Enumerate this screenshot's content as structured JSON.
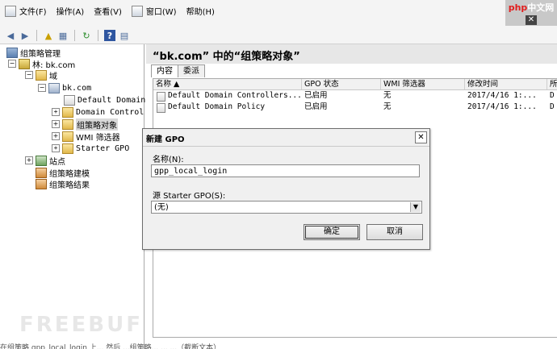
{
  "menubar": {
    "items": [
      "文件(F)",
      "操作(A)",
      "查看(V)",
      "窗口(W)",
      "帮助(H)"
    ],
    "window_controls": [
      "_",
      "▫",
      "×"
    ]
  },
  "watermark": {
    "brand_prefix": "php",
    "brand_suffix": "中文网",
    "close_glyph": "✕"
  },
  "toolbar": {
    "buttons": [
      "back-icon",
      "forward-icon",
      "up-icon",
      "show-hide-tree-icon",
      "refresh-icon",
      "help-icon",
      "view-icon"
    ]
  },
  "tree": {
    "root": "组策略管理",
    "forest": "林: bk.com",
    "domains": "域",
    "domain": "bk.com",
    "items": [
      "Default Domain",
      "Domain Control",
      "组策略对象",
      "WMI 筛选器",
      "Starter GPO"
    ],
    "sites": "站点",
    "modeling": "组策略建模",
    "results": "组策略结果"
  },
  "main": {
    "title": "“bk.com” 中的“组策略对象”",
    "tabs": [
      "内容",
      "委派"
    ],
    "columns": [
      "名称 ▲",
      "GPO 状态",
      "WMI 筛选器",
      "修改时间",
      "所"
    ],
    "rows": [
      [
        "Default Domain Controllers...",
        "已启用",
        "无",
        "2017/4/16 1:...",
        "D"
      ],
      [
        "Default Domain Policy",
        "已启用",
        "无",
        "2017/4/16 1:...",
        "D"
      ]
    ]
  },
  "dialog": {
    "title": "新建 GPO",
    "name_label": "名称(N):",
    "name_value": "gpp_local_login",
    "starter_label": "源 Starter GPO(S):",
    "starter_value": "(无)",
    "ok_label": "确定",
    "cancel_label": "取消",
    "close_glyph": "✕"
  },
  "bottom": {
    "freebuf": "FREEBUF",
    "caption": "在组策略 gpp_local_login 上... 然后 ...组策略... ... ...（截断文本）"
  }
}
